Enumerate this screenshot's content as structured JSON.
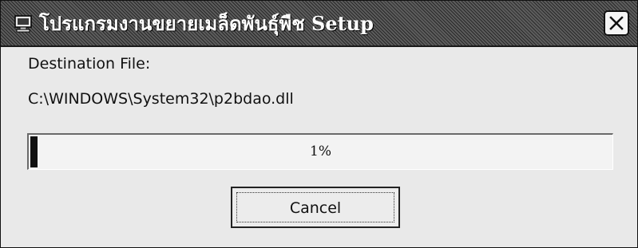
{
  "window": {
    "title": "โปรแกรมงานขยายเมล็ดพันธุ์พืช Setup",
    "app_icon": "computer-icon",
    "close_icon": "close-icon"
  },
  "content": {
    "destination_label": "Destination File:",
    "destination_path": "C:\\WINDOWS\\System32\\p2bdao.dll"
  },
  "progress": {
    "percent": 1,
    "text": "1%"
  },
  "buttons": {
    "cancel_label": "Cancel"
  }
}
